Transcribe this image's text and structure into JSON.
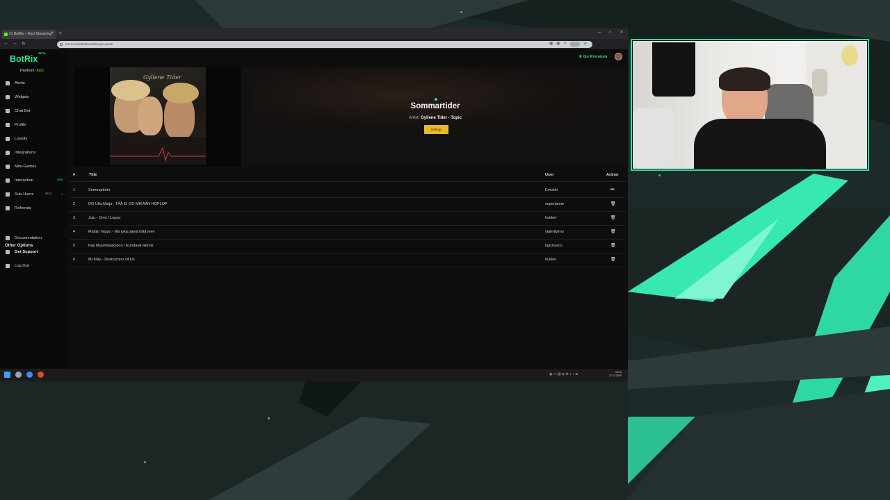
{
  "browser": {
    "tab_title": "#1 BotRix – Best Streaming",
    "tab_close": "×",
    "new_tab": "+",
    "url": "botrix.live/dashboard/songrequest/"
  },
  "sidebar": {
    "logo": "BotRix",
    "logo_badge": "BETA",
    "platform_label": "Platform:",
    "platform_value": "Kick",
    "items": [
      {
        "label": "Alerts"
      },
      {
        "label": "Widgets"
      },
      {
        "label": "Chat Bot"
      },
      {
        "label": "Profile"
      },
      {
        "label": "Loyalty"
      },
      {
        "label": "Integrations"
      },
      {
        "label": "Mini-Games"
      },
      {
        "label": "Interaction",
        "badge": "NEW"
      },
      {
        "label": "Sub-Users",
        "badge": "BETA"
      },
      {
        "label": "Referrals"
      }
    ],
    "other_options_heading": "Other Options",
    "other_items": [
      {
        "label": "Documentation"
      },
      {
        "label": "Get Support"
      },
      {
        "label": "Log Out"
      }
    ]
  },
  "header": {
    "premium_label": "Go Premium"
  },
  "player": {
    "album_cover_text": "Gyllene Tider",
    "song_title": "Sommartider",
    "artist_label": "Artist:",
    "artist_value": "Gyllene Tider - Topic",
    "settings_button": "Settings"
  },
  "queue": {
    "columns": {
      "num": "#",
      "title": "Title",
      "user": "User",
      "action": "Action"
    },
    "rows": [
      {
        "num": "1",
        "title": "Sommartider",
        "user": "Emokki",
        "action": "skip"
      },
      {
        "num": "2",
        "title": "DG Ulla-Maija - TÄÄ EI OO MIKÄÄN HOPLOP",
        "user": "superjanne",
        "action": "delete"
      },
      {
        "num": "3",
        "title": "Juju - Onni / Loppu",
        "user": "hukkel",
        "action": "delete"
      },
      {
        "num": "4",
        "title": "Mattijo Teppo - Mä joka päivä töitä teen",
        "user": "ylahyllylmo",
        "action": "delete"
      },
      {
        "num": "5",
        "title": "Käy Muumilaaksoon / Eurobeat Remix",
        "user": "lupchasco",
        "action": "delete"
      },
      {
        "num": "6",
        "title": "Mr.Kitty - Destruction Of Us",
        "user": "hukkel",
        "action": "delete"
      }
    ]
  },
  "taskbar": {
    "time": "13:41",
    "date": "17.12.2025"
  },
  "colors": {
    "accent": "#2be38f",
    "kick_green": "#53fc18",
    "settings_yellow": "#e7b92a",
    "webcam_border": "#2be3a9"
  }
}
